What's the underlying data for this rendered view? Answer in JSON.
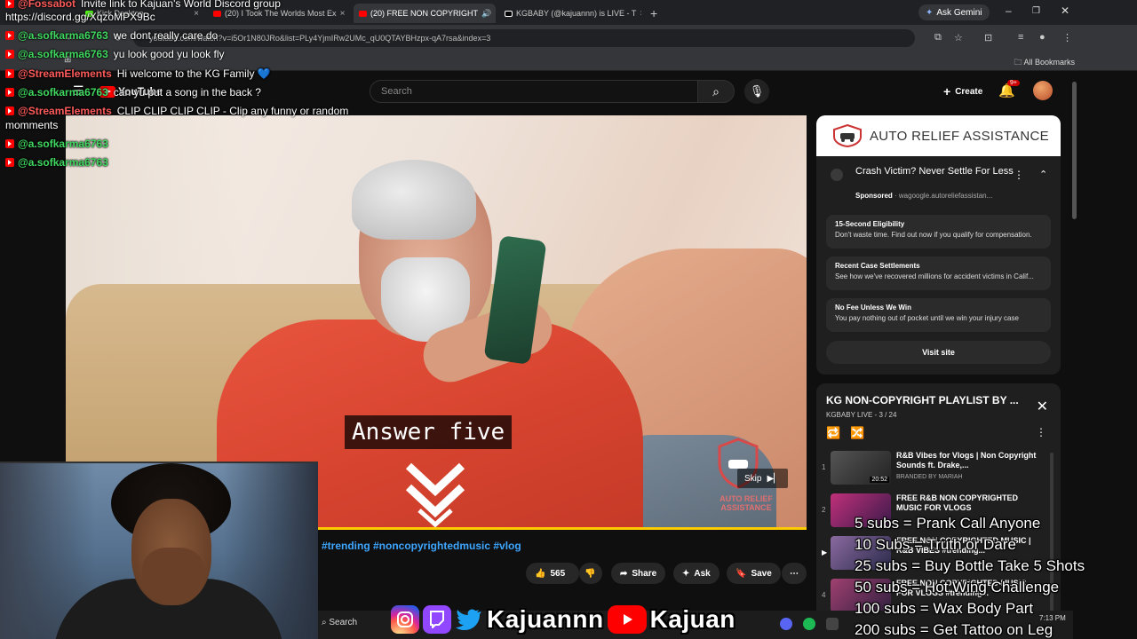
{
  "browser": {
    "tabs": [
      {
        "label": "Kick Desktop"
      },
      {
        "label": "(20) I Took The Worlds Most Ex"
      },
      {
        "label": "(20) FREE NON COPYRIGHT",
        "active": true
      },
      {
        "label": "KGBABY (@kajuannn) is LIVE - T"
      }
    ],
    "ask_gemini": "Ask Gemini",
    "url": "youtube.com/watch?v=i5Or1N80JRo&list=PLy4YjmIRw2UMc_qU0QTAYBHzpx-qA7rsa&index=3",
    "all_bookmarks": "All Bookmarks"
  },
  "youtube": {
    "logo": "YouTube",
    "search_placeholder": "Search",
    "create_label": "Create",
    "notif_count": "9+"
  },
  "video": {
    "caption": "Answer five",
    "skip_label": "Skip",
    "watermark": "AUTO RELIEF\nASSISTANCE"
  },
  "below_video": {
    "tags": "#trending #noncopyrightedmusic #vlog",
    "likes": "565",
    "share": "Share",
    "ask": "Ask",
    "save": "Save"
  },
  "ad": {
    "brand": "AUTO RELIEF ASSISTANCE",
    "title": "Crash Victim? Never Settle For Less",
    "sponsored": "Sponsored",
    "domain": "wagoogle.autoreliefassistan...",
    "cards": [
      {
        "heading": "15-Second Eligibility",
        "desc": "Don't waste time. Find out now if you qualify for compensation."
      },
      {
        "heading": "Recent Case Settlements",
        "desc": "See how we've recovered millions for accident victims in Calif..."
      },
      {
        "heading": "No Fee Unless We Win",
        "desc": "You pay nothing out of pocket until we win your injury case"
      }
    ],
    "visit_label": "Visit site"
  },
  "playlist": {
    "title": "KG NON-COPYRIGHT PLAYLIST BY ...",
    "channel": "KGBABY LIVE",
    "position": "3 / 24",
    "items": [
      {
        "index": "1",
        "title": "R&B Vibes for Vlogs | Non Copyright Sounds ft. Drake,...",
        "channel": "BRANDED BY MARIAH",
        "duration": "20:52"
      },
      {
        "index": "2",
        "title": "FREE R&B NON COPYRIGHTED MUSIC FOR VLOGS",
        "channel": "",
        "duration": ""
      },
      {
        "index": "",
        "title": "FREE NON COPYRIGHTED MUSIC | R&B VIBES #trending...",
        "channel": "",
        "duration": ""
      },
      {
        "index": "4",
        "title": "FREE NON COPYRIGHTED MUSIC FOR VLOGS #trending...",
        "channel": "",
        "duration": ""
      }
    ]
  },
  "chat": [
    {
      "name": "@Fossabot",
      "msg": "Invite link to Kajuan's World Discord group",
      "type": "se"
    },
    {
      "name": "",
      "msg": "https://discord.gg/XqzoMPX9Bc",
      "type": "plain"
    },
    {
      "name": "@a.sofkarma6763",
      "msg": "we dont really care do",
      "type": "user"
    },
    {
      "name": "@a.sofkarma6763",
      "msg": "yu look good yu look fly",
      "type": "user"
    },
    {
      "name": "@StreamElements",
      "msg": "Hi welcome to the KG Family 💙",
      "type": "se"
    },
    {
      "name": "@a.sofkarma6763",
      "msg": "can yu put a song in the back ?",
      "type": "user"
    },
    {
      "name": "@StreamElements",
      "msg": "CLIP CLIP CLIP CLIP - Clip any funny or random",
      "type": "se"
    },
    {
      "name": "",
      "msg": "momments",
      "type": "plain"
    },
    {
      "name": "@a.sofkarma6763",
      "msg": "",
      "type": "user"
    },
    {
      "name": "@a.sofkarma6763",
      "msg": "",
      "type": "user"
    }
  ],
  "goals": [
    "5 subs = Prank Call Anyone",
    "10 Subs = Truth or Dare",
    "25 subs = Buy Bottle Take 5 Shots",
    "50 subs = Hot Wing Challenge",
    "100 subs = Wax Body Part",
    "200 subs = Get Tattoo on Leg"
  ],
  "socials": {
    "twitch_twitter_name": "Kajuannn",
    "youtube_name": "Kajuan"
  },
  "taskbar": {
    "search": "Search",
    "time": "7:13 PM"
  },
  "colors": {
    "accent_blue": "#3ea6ff",
    "yt_red": "#ff0000",
    "progress": "#ffcc00"
  }
}
